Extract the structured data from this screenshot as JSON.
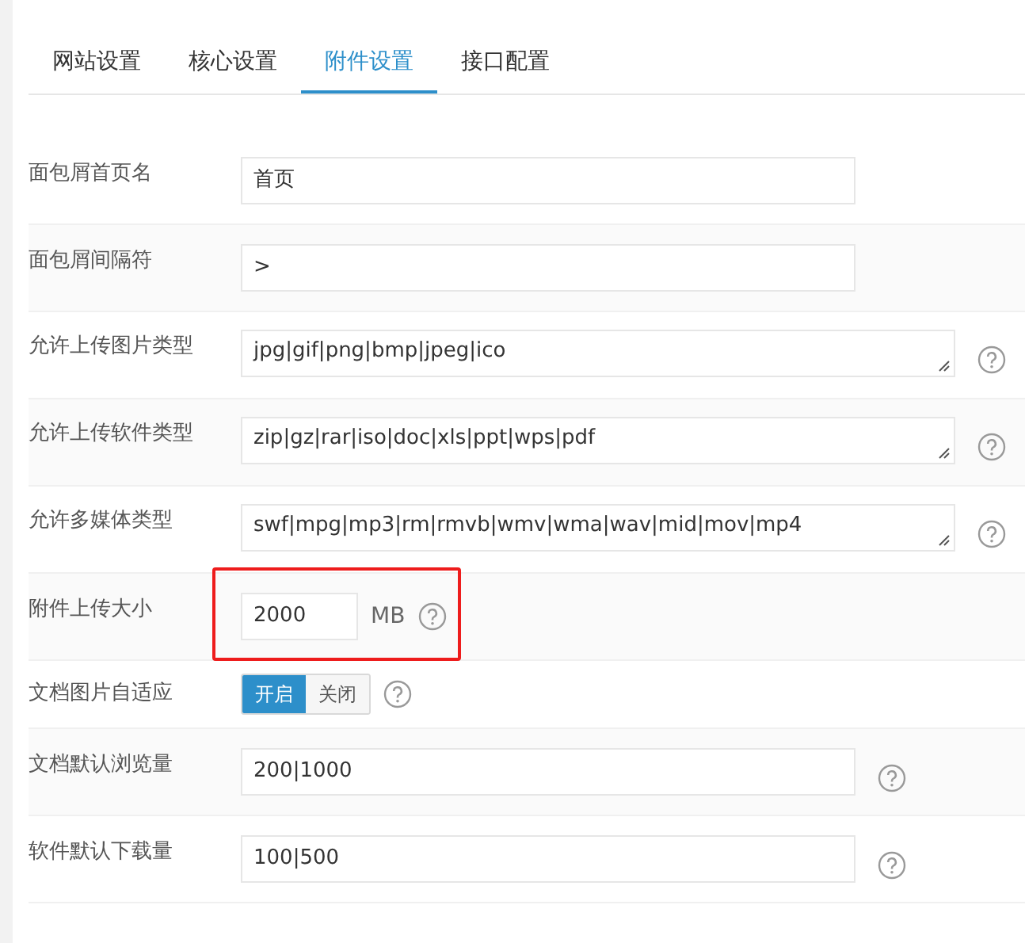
{
  "tabs": [
    {
      "label": "网站设置",
      "selected": false
    },
    {
      "label": "核心设置",
      "selected": false
    },
    {
      "label": "附件设置",
      "selected": true
    },
    {
      "label": "接口配置",
      "selected": false
    }
  ],
  "rows": [
    {
      "kind": "text",
      "label": "面包屑首页名",
      "value": "首页",
      "help": false,
      "highlighted": false
    },
    {
      "kind": "text",
      "label": "面包屑间隔符",
      "value": ">",
      "help": false,
      "highlighted": false
    },
    {
      "kind": "textarea",
      "label": "允许上传图片类型",
      "value": "jpg|gif|png|bmp|jpeg|ico",
      "help": true,
      "highlighted": false
    },
    {
      "kind": "textarea",
      "label": "允许上传软件类型",
      "value": "zip|gz|rar|iso|doc|xls|ppt|wps|pdf",
      "help": true,
      "highlighted": false
    },
    {
      "kind": "textarea",
      "label": "允许多媒体类型",
      "value": "swf|mpg|mp3|rm|rmvb|wmv|wma|wav|mid|mov|mp4",
      "help": true,
      "highlighted": false
    },
    {
      "kind": "size",
      "label": "附件上传大小",
      "value": "2000",
      "unit": "MB",
      "help": true,
      "highlighted": true
    },
    {
      "kind": "toggle",
      "label": "文档图片自适应",
      "options": [
        {
          "label": "开启",
          "selected": true
        },
        {
          "label": "关闭",
          "selected": false
        }
      ],
      "help": true,
      "highlighted": false
    },
    {
      "kind": "text",
      "label": "文档默认浏览量",
      "value": "200|1000",
      "help": true,
      "highlighted": false
    },
    {
      "kind": "text",
      "label": "软件默认下载量",
      "value": "100|500",
      "help": true,
      "highlighted": false
    }
  ]
}
